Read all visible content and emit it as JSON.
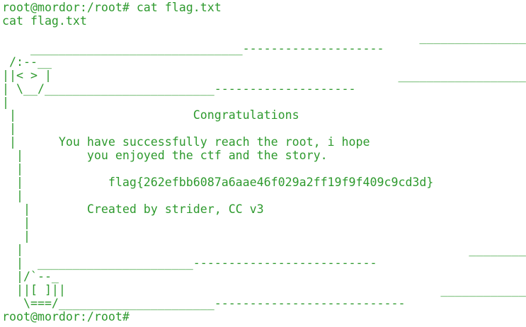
{
  "terminal": {
    "prompt": "root@mordor:/root#",
    "command": "cat flag.txt",
    "lines": [
      "root@mordor:/root# cat flag.txt",
      "cat flag.txt",
      "                                                           ___________________________",
      "    ______________________________--------------------                             `\\",
      " /:--__                                                                              |",
      "||< > |                                                 ______________________________/",
      "| \\__/________________________--------------------                                 |",
      "|                                                                                  |",
      " |                         Congratulations                                         |",
      " |                                                                                  |",
      " |      You have successfully reach the root, i hope                                |",
      "  |         you enjoyed the ctf and the story.                                      |",
      "  |                                                                                  |",
      "  |            flag{262efbb6087a6aae46f029a2ff19f9f409c9cd3d}                        |",
      "  |                                                                                   |",
      "   |        Created by strider, CC v3                                                 |",
      "   |                                                                                  |",
      "   |                                                                                 |",
      "  |                                                               ___________________|_",
      "  |  ______________________--------------------------                                 `\\",
      "  |/`--_                                                                               |",
      "  ||[ ]||                                                     ____________________________/",
      "   \\===/______________________---------------------------",
      "root@mordor:/root#"
    ]
  }
}
